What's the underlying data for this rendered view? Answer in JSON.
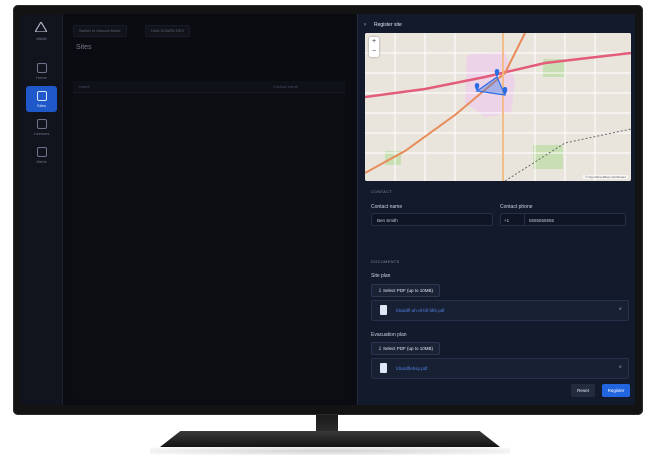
{
  "nav": {
    "logo_text": "MAIN",
    "items": [
      {
        "label": "Home"
      },
      {
        "label": "Sites"
      },
      {
        "label": "Licenses"
      },
      {
        "label": "Alerts"
      }
    ]
  },
  "topbar": {
    "switch_label": "Switch to Manual Mode",
    "org_label": "DAN SOARD DEV"
  },
  "main": {
    "title": "Sites",
    "columns": [
      "Name",
      "Contact name"
    ]
  },
  "panel": {
    "title": "Register site",
    "map": {
      "zoom_in": "+",
      "zoom_out": "−",
      "attribution": "© OpenStreetMap contributors"
    },
    "contact_section": "Contact",
    "contact_name_label": "Contact name",
    "contact_name_value": "Ben Smith",
    "contact_phone_label": "Contact phone",
    "phone_prefix": "+1",
    "contact_phone_value": "5555555555",
    "documents_section": "Documents",
    "site_plan_label": "Site plan",
    "site_plan_button": "⇩ Select PDF (up to 10MB)",
    "site_plan_file": "fdsaldfl-ah-dl-fdl-fdfe.pdf",
    "evacuation_label": "Evacuation plan",
    "evacuation_button": "⇩ Select PDF (up to 10MB)",
    "evacuation_file": "fdsaldflehsp.pdf",
    "reset_label": "Reset",
    "register_label": "Register"
  },
  "colors": {
    "accent": "#2166e0",
    "panel_bg": "#131a2b",
    "link": "#4f7fe0"
  }
}
